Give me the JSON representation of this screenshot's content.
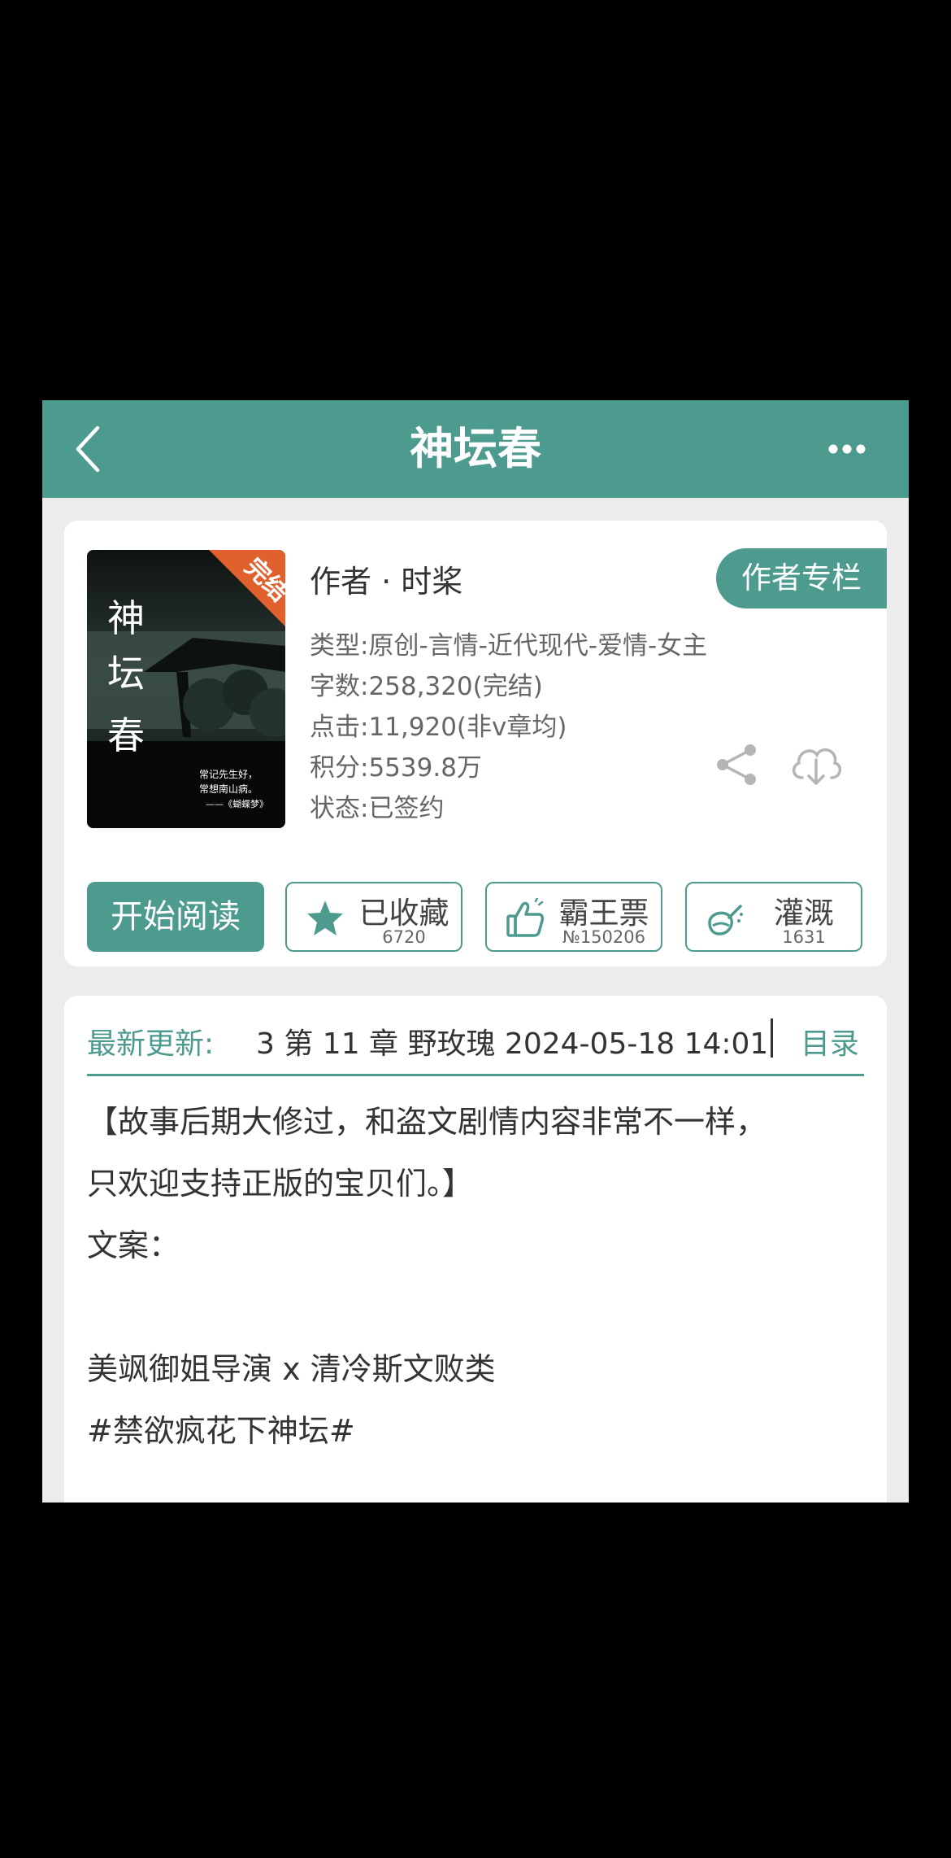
{
  "nav": {
    "title": "神坛春"
  },
  "book": {
    "cover": {
      "title_chars": [
        "神",
        "坛",
        "春"
      ],
      "badge": "完结",
      "quote_line1": "常记先生好，",
      "quote_line2": "常想南山病。",
      "quote_source": "——《蝴蝶梦》"
    },
    "author": "作者 · 时桨",
    "author_column_label": "作者专栏",
    "info": {
      "category": "类型:原创-言情-近代现代-爱情-女主",
      "word_count": "字数:258,320(完结)",
      "clicks": "点击:11,920(非v章均)",
      "points": "积分:5539.8万",
      "status": "状态:已签约"
    }
  },
  "actions": {
    "read_label": "开始阅读",
    "favorite": {
      "label": "已收藏",
      "count": "6720"
    },
    "vote": {
      "label": "霸王票",
      "count": "№150206"
    },
    "water": {
      "label": "灌溉",
      "count": "1631"
    }
  },
  "update": {
    "label": "最新更新:",
    "text": "3   第 11 章 野玫瑰 2024-05-18 14:01",
    "toc_label": "目录"
  },
  "description": {
    "lines": [
      "【故事后期大修过，和盗文剧情内容非常不一样，",
      "只欢迎支持正版的宝贝们。】",
      "文案：",
      "",
      "美飒御姐导演 x 清冷斯文败类",
      "#禁欲疯花下神坛#"
    ]
  },
  "colors": {
    "accent": "#4d9a8f",
    "badge": "#e0602e",
    "page_background": "#ececec"
  },
  "icons": [
    "back-arrow-icon",
    "more-dots-icon",
    "share-icon",
    "download-cloud-icon",
    "star-icon",
    "thumbs-up-icon",
    "watering-can-icon"
  ]
}
